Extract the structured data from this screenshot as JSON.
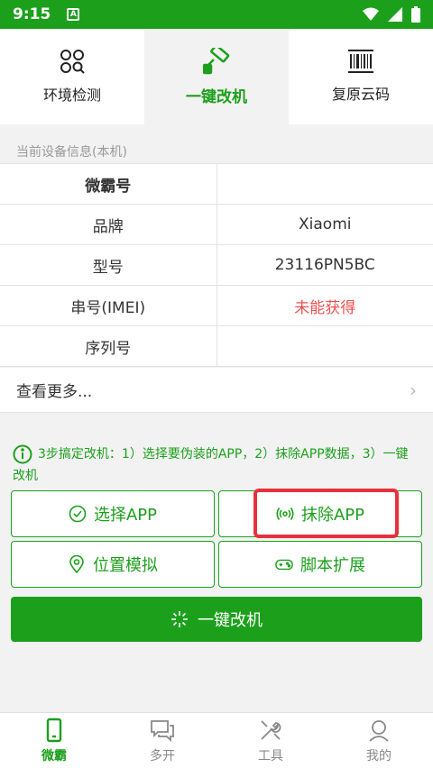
{
  "status_bar": {
    "time": "9:15",
    "notification_icon": "A"
  },
  "tabs": [
    {
      "label": "环境检测",
      "icon": "env-check-icon"
    },
    {
      "label": "一键改机",
      "icon": "paint-roller-icon",
      "active": true
    },
    {
      "label": "复原云码",
      "icon": "barcode-icon"
    }
  ],
  "device_info": {
    "section_title": "当前设备信息(本机)",
    "rows": [
      {
        "label": "微霸号",
        "value": ""
      },
      {
        "label": "品牌",
        "value": "Xiaomi"
      },
      {
        "label": "型号",
        "value": "23116PN5BC"
      },
      {
        "label": "串号(IMEI)",
        "value": "未能获得"
      },
      {
        "label": "序列号",
        "value": ""
      }
    ],
    "more_label": "查看更多..."
  },
  "tip": {
    "text": "3步搞定改机：1）选择要伪装的APP，2）抹除APP数据，3）一键改机"
  },
  "actions": {
    "select_app": "选择APP",
    "erase_app": "抹除APP",
    "location": "位置模拟",
    "script": "脚本扩展",
    "one_key": "一键改机"
  },
  "bottom_nav": [
    {
      "label": "微霸",
      "active": true
    },
    {
      "label": "多开"
    },
    {
      "label": "工具"
    },
    {
      "label": "我的"
    }
  ],
  "colors": {
    "brand_green": "#1ca01c",
    "warning_red": "#f05050",
    "highlight_red": "#e8303c"
  }
}
